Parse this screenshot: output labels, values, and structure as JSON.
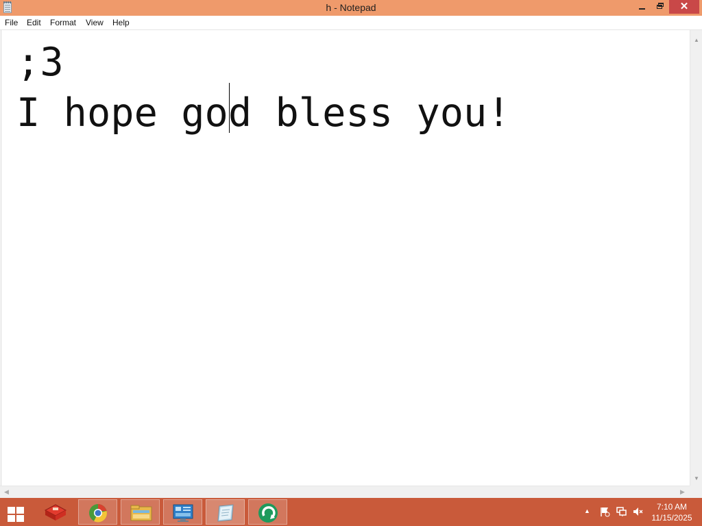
{
  "window": {
    "title": "h - Notepad",
    "controls": {
      "minimize": "minimize",
      "restore": "restore",
      "close": "✕"
    }
  },
  "menu": {
    "items": [
      "File",
      "Edit",
      "Format",
      "View",
      "Help"
    ]
  },
  "editor": {
    "lines": [
      ";3",
      "I hope god bless you!"
    ]
  },
  "taskbar": {
    "apps": [
      {
        "icon": "toolbox-icon"
      },
      {
        "icon": "chrome-icon"
      },
      {
        "icon": "file-explorer-icon"
      },
      {
        "icon": "control-panel-icon"
      },
      {
        "icon": "notepad-icon"
      },
      {
        "icon": "green-app-icon"
      }
    ],
    "tray": {
      "chevron": "▲",
      "time": "7:10 AM",
      "date": "11/15/2025"
    }
  },
  "colors": {
    "titlebar": "#ef9a6b",
    "close_button": "#c94848",
    "taskbar": "#c95a3a"
  }
}
